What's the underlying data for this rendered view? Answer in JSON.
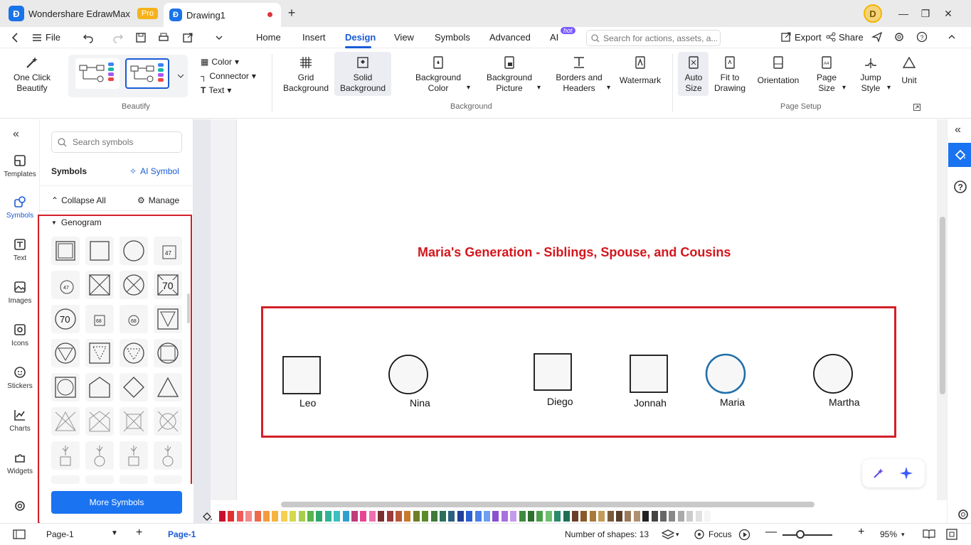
{
  "app": {
    "name": "Wondershare EdrawMax",
    "badge": "Pro",
    "doc_tab": "Drawing1",
    "avatar": "D"
  },
  "menu": {
    "file": "File",
    "home": "Home",
    "insert": "Insert",
    "design": "Design",
    "view": "View",
    "symbols": "Symbols",
    "advanced": "Advanced",
    "ai": "AI",
    "hot": "hot",
    "search_placeholder": "Search for actions, assets, a...",
    "export": "Export",
    "share": "Share"
  },
  "ribbon": {
    "one_click": [
      "One Click",
      "Beautify"
    ],
    "color": "Color",
    "connector": "Connector",
    "text": "Text",
    "beautify_group": "Beautify",
    "grid_bg": [
      "Grid",
      "Background"
    ],
    "solid_bg": [
      "Solid",
      "Background"
    ],
    "bg_color": [
      "Background",
      "Color"
    ],
    "bg_picture": [
      "Background",
      "Picture"
    ],
    "borders": [
      "Borders and",
      "Headers"
    ],
    "watermark": "Watermark",
    "background_group": "Background",
    "auto_size": [
      "Auto",
      "Size"
    ],
    "fit": [
      "Fit to",
      "Drawing"
    ],
    "orientation": "Orientation",
    "page_size": [
      "Page",
      "Size"
    ],
    "jump": [
      "Jump",
      "Style"
    ],
    "unit": "Unit",
    "page_setup_group": "Page Setup"
  },
  "leftnav": [
    "Templates",
    "Symbols",
    "Text",
    "Images",
    "Icons",
    "Stickers",
    "Charts",
    "Widgets"
  ],
  "sympanel": {
    "search_placeholder": "Search symbols",
    "title": "Symbols",
    "ai_symbol": "AI Symbol",
    "collapse": "Collapse All",
    "manage": "Manage",
    "category": "Genogram",
    "more": "More Symbols"
  },
  "canvas": {
    "title": "Maria's Generation - Siblings, Spouse, and Cousins",
    "people": [
      "Leo",
      "Nina",
      "Diego",
      "Jonnah",
      "Maria",
      "Martha"
    ]
  },
  "status": {
    "page_select": "Page-1",
    "page_tab": "Page-1",
    "shapes": "Number of shapes: 13",
    "focus": "Focus",
    "zoom": "95%"
  },
  "colors": {
    "accent": "#1a5bd6",
    "highlight": "#d32029",
    "title": "#d4161c",
    "maria_stroke": "#1f6fa8"
  }
}
